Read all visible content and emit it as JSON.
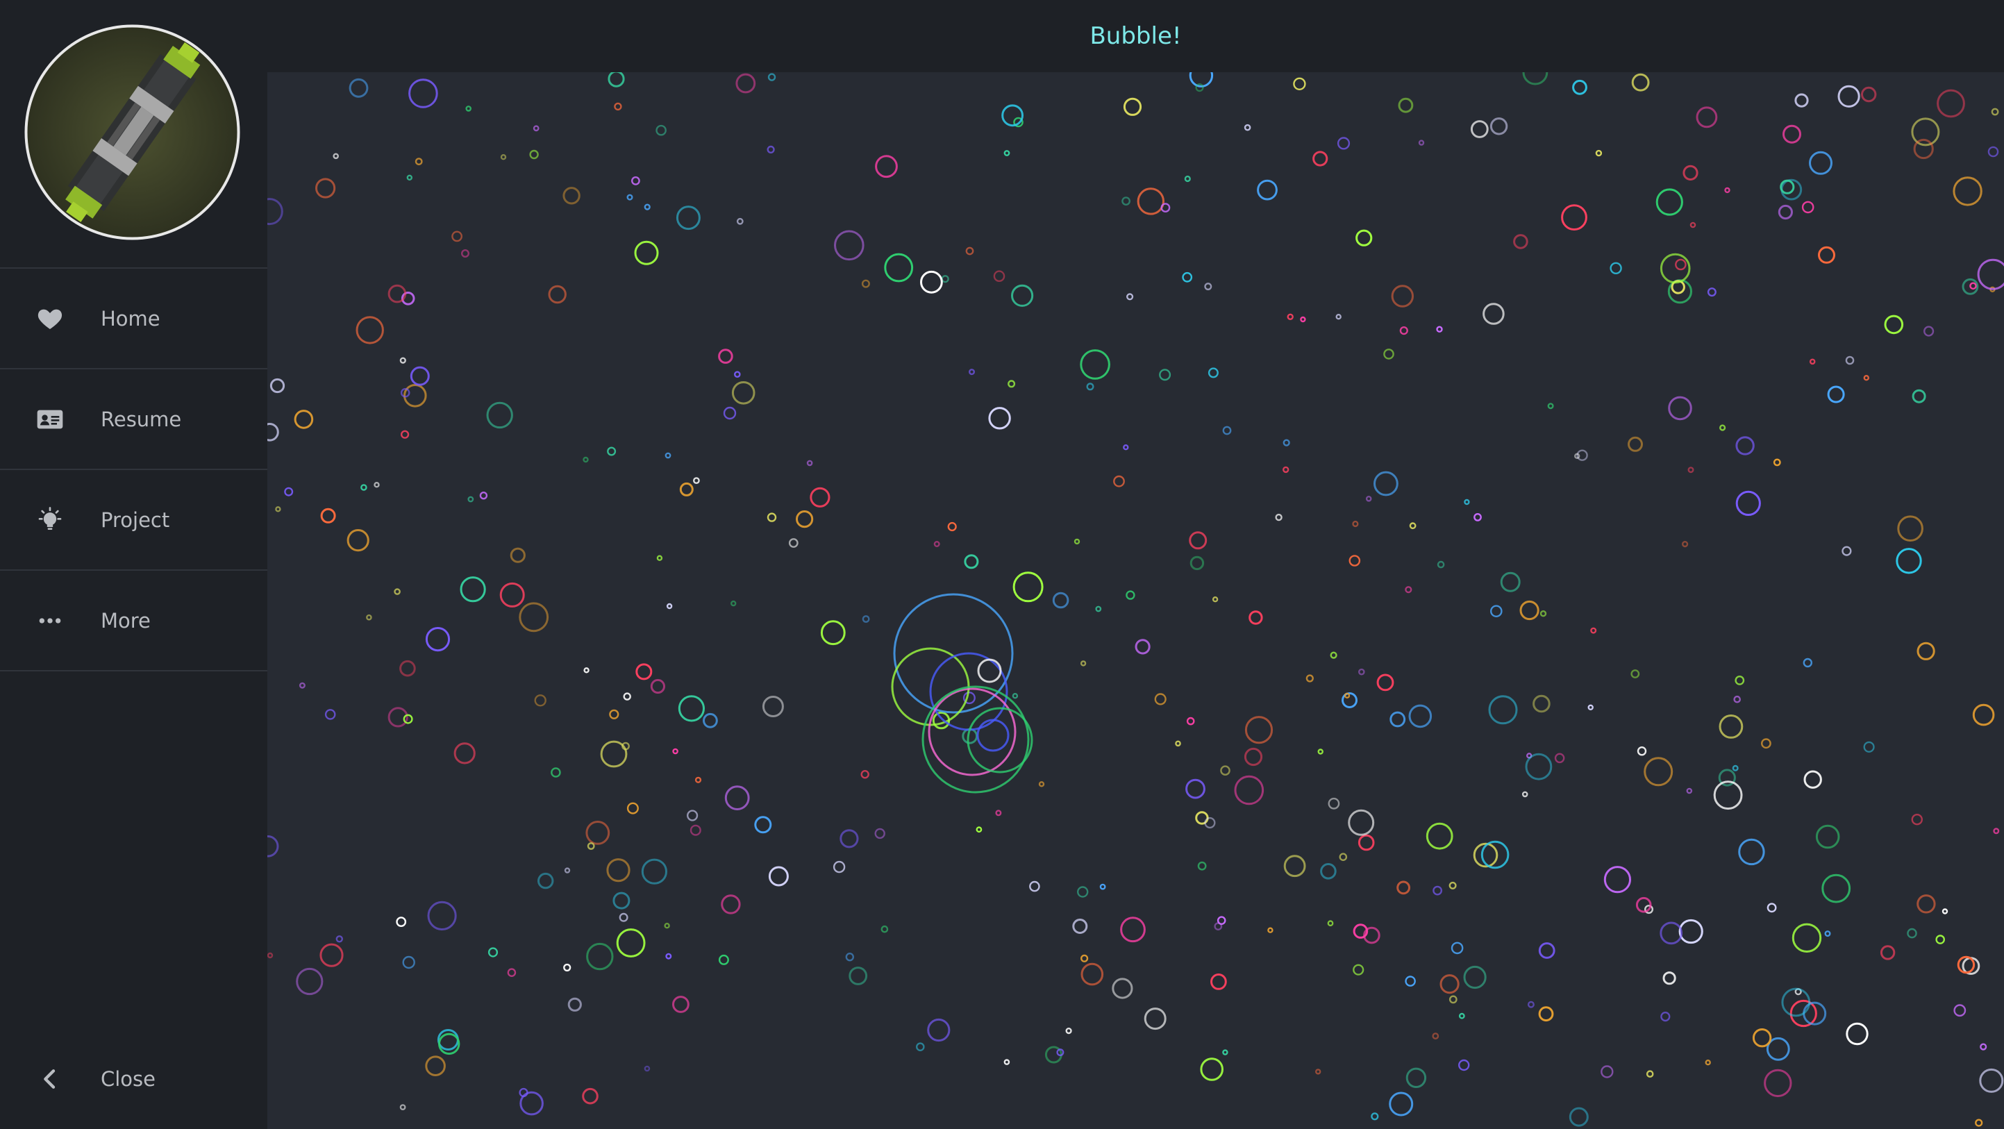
{
  "header": {
    "title": "Bubble!"
  },
  "sidebar": {
    "logo": {
      "icon": "capacitor-pixel-art-icon"
    },
    "items": [
      {
        "label": "Home",
        "icon": "heart-icon"
      },
      {
        "label": "Resume",
        "icon": "id-card-icon"
      },
      {
        "label": "Project",
        "icon": "lightbulb-icon"
      },
      {
        "label": "More",
        "icon": "ellipsis-icon"
      }
    ],
    "close": {
      "label": "Close",
      "icon": "chevron-left-icon"
    }
  },
  "colors": {
    "sidebar_bg": "#1e2126",
    "canvas_bg": "#272b33",
    "title": "#7ee8e8",
    "nav_text": "#b9bcc1",
    "bubble_palette": [
      "#36d1a0",
      "#e0e060",
      "#ff6b3d",
      "#ff3fa8",
      "#4aa8ff",
      "#7a5cff",
      "#c86bff",
      "#30d070",
      "#e8a030",
      "#ffffff",
      "#d8d8ff",
      "#2ec8e8",
      "#ff4060",
      "#a0ff40"
    ]
  }
}
